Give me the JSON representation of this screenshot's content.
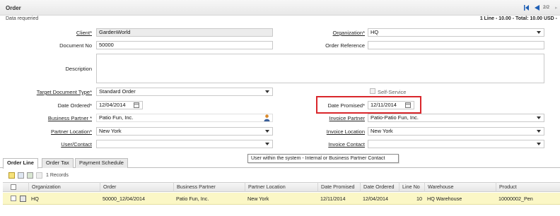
{
  "header": {
    "title": "Order",
    "record_position": "2/2"
  },
  "status": {
    "message": "Data requeried",
    "summary": "1 Line - 10.00 - Total: 10.00 USD -"
  },
  "form": {
    "client": {
      "label": "Client",
      "value": "GardenWorld"
    },
    "organization": {
      "label": "Organization",
      "value": "HQ"
    },
    "document_no": {
      "label": "Document No",
      "value": "50000"
    },
    "order_reference": {
      "label": "Order Reference",
      "value": ""
    },
    "description": {
      "label": "Description",
      "value": ""
    },
    "target_document_type": {
      "label": "Target Document Type",
      "value": "Standard Order"
    },
    "self_service": {
      "label": "Self-Service",
      "checked": false
    },
    "date_ordered": {
      "label": "Date Ordered",
      "value": "12/04/2014"
    },
    "date_promised": {
      "label": "Date Promised",
      "value": "12/11/2014"
    },
    "business_partner": {
      "label": "Business Partner ",
      "value": "Patio Fun, Inc."
    },
    "invoice_partner": {
      "label": "Invoice Partner",
      "value": "Patio-Patio Fun, Inc."
    },
    "partner_location": {
      "label": "Partner Location",
      "value": "New York"
    },
    "invoice_location": {
      "label": "Invoice Location",
      "value": "New York"
    },
    "user_contact": {
      "label": "User/Contact",
      "value": ""
    },
    "invoice_contact": {
      "label": "Invoice Contact",
      "value": ""
    },
    "required_mark": "*"
  },
  "tooltip": "User within the system - Internal or Business Partner Contact",
  "tabs": [
    {
      "label": "Order Line",
      "active": true
    },
    {
      "label": "Order Tax",
      "active": false
    },
    {
      "label": "Payment Schedule",
      "active": false
    }
  ],
  "grid": {
    "record_count": "1 Records",
    "columns": [
      "Organization",
      "Order",
      "Business Partner",
      "Partner Location",
      "Date Promised",
      "Date Ordered",
      "Line No",
      "Warehouse",
      "Product"
    ],
    "rows": [
      {
        "organization": "HQ",
        "order": "50000_12/04/2014",
        "business_partner": "Patio Fun, Inc.",
        "partner_location": "New York",
        "date_promised": "12/11/2014",
        "date_ordered": "12/04/2014",
        "line_no": "10",
        "warehouse": "HQ Warehouse",
        "product": "10000002_Pen"
      }
    ]
  },
  "colors": {
    "highlight_border": "#d9262b",
    "selected_row": "#fbf7c6",
    "nav_arrow": "#1f5fb5"
  },
  "icons": {
    "first_record": "first-record-icon",
    "previous_record": "previous-record-icon",
    "next_record": "next-record-icon",
    "calendar": "calendar-icon",
    "business_partner_lookup": "person-icon",
    "new_record": "new-record-icon",
    "grid_edit": "edit-row-icon"
  }
}
